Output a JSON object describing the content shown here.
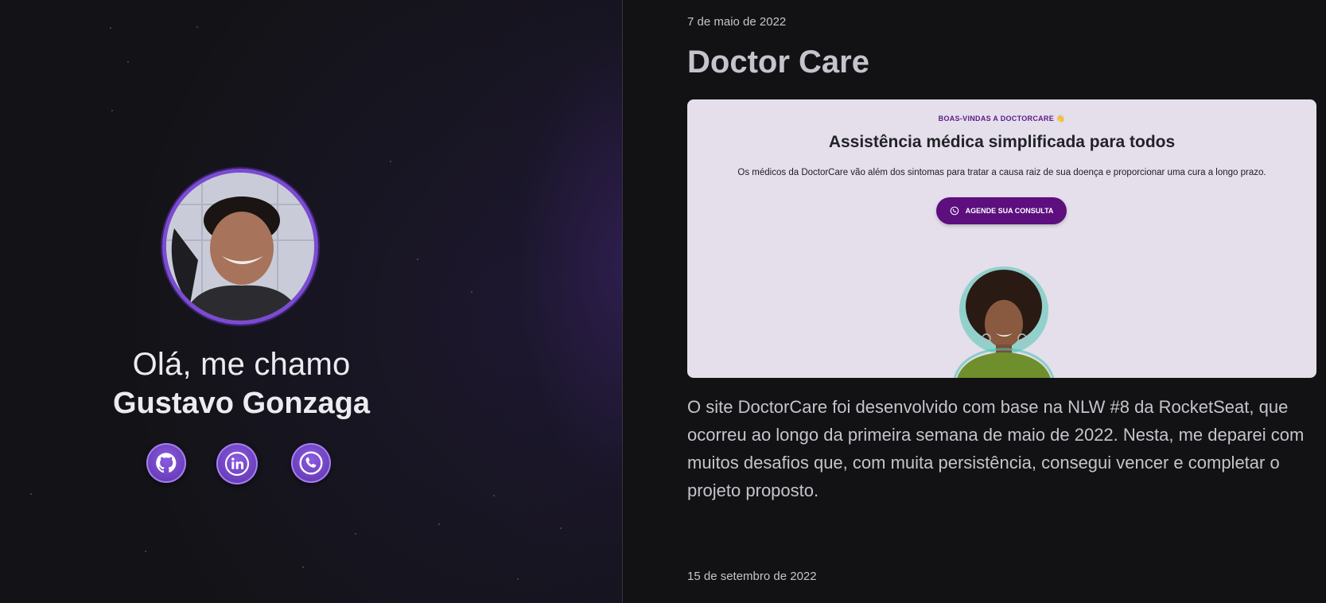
{
  "profile": {
    "greeting": "Olá, me chamo",
    "name": "Gustavo Gonzaga",
    "avatar_icon": "user-photo",
    "socials": [
      {
        "label": "GitHub",
        "icon": "github-icon"
      },
      {
        "label": "LinkedIn",
        "icon": "linkedin-icon"
      },
      {
        "label": "WhatsApp",
        "icon": "whatsapp-icon"
      }
    ],
    "accent_color": "#7b4bd1"
  },
  "posts": [
    {
      "date": "7 de maio de 2022",
      "title": "Doctor Care",
      "preview": {
        "eyebrow": "BOAS-VINDAS A DOCTORCARE 👋",
        "headline": "Assistência médica simplificada para todos",
        "description": "Os médicos da DoctorCare vão além dos sintomas para tratar a causa raiz de sua doença e proporcionar uma cura a longo prazo.",
        "cta_label": "AGENDE SUA CONSULTA",
        "cta_color": "#5c0f7d",
        "background": "#e4dfea"
      },
      "body": "O site DoctorCare foi desenvolvido com base na NLW #8 da RocketSeat, que ocorreu ao longo da primeira semana de maio de 2022. Nesta, me deparei com muitos desafios que, com muita persistência, consegui vencer e completar o projeto proposto."
    },
    {
      "date": "15 de setembro de 2022"
    }
  ]
}
